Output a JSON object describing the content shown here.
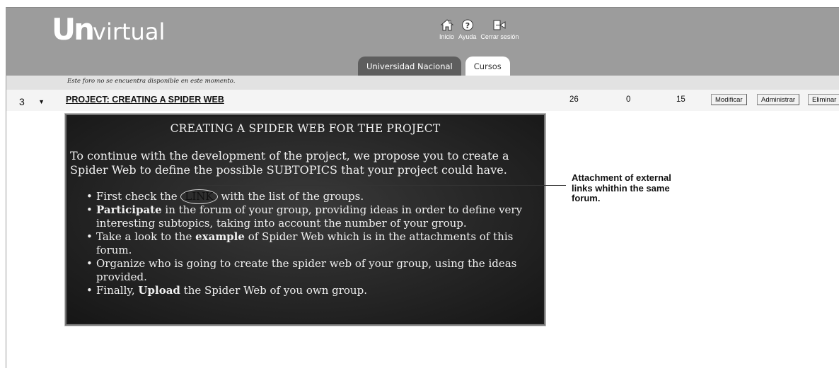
{
  "header": {
    "logo_u": "U",
    "logo_n": "n",
    "logo_text": "virtual",
    "nav": [
      {
        "label": "Inicio",
        "icon": "home-icon"
      },
      {
        "label": "Ayuda",
        "icon": "help-icon"
      },
      {
        "label": "Cerrar sesión",
        "icon": "logout-icon"
      }
    ],
    "tabs": [
      {
        "label": "Universidad Nacional",
        "active": false
      },
      {
        "label": "Cursos",
        "active": true
      }
    ]
  },
  "notice": "Este foro no se encuentra disponible en este momento.",
  "forum": {
    "order": "3",
    "title": "PROJECT: CREATING A SPIDER WEB",
    "stats": [
      "26",
      "0",
      "15"
    ],
    "buttons": {
      "modify": "Modificar",
      "admin": "Administrar",
      "delete": "Eliminar"
    }
  },
  "panel": {
    "heading": "CREATING A SPIDER WEB FOR THE PROJECT",
    "intro": "To continue with the development of the project, we propose you to create a Spider Web to define the possible SUBTOPICS that your project could have.",
    "bullets": [
      {
        "pre": "First check the ",
        "link": "LINK",
        "post": " with the list of the groups."
      },
      {
        "bold": "Participate",
        "text": " in the forum of your group, providing ideas in order to define very interesting subtopics, taking into account the number of your group."
      },
      {
        "pre": "Take a look to the ",
        "bold": "example",
        "post": " of Spider Web which is in the attachments of this forum."
      },
      {
        "text": "Organize who is going to create the spider web of your group, using the ideas provided."
      },
      {
        "pre": "Finally, ",
        "bold": "Upload",
        "post": " the Spider Web of you own group."
      }
    ]
  },
  "annotation": "Attachment of external links whithin the same forum.",
  "colors": {
    "header_bg": "#9c9c9c",
    "active_tab_bg": "#ffffff",
    "inactive_tab_bg": "#5e5e5e",
    "panel_bg": "#262626"
  }
}
